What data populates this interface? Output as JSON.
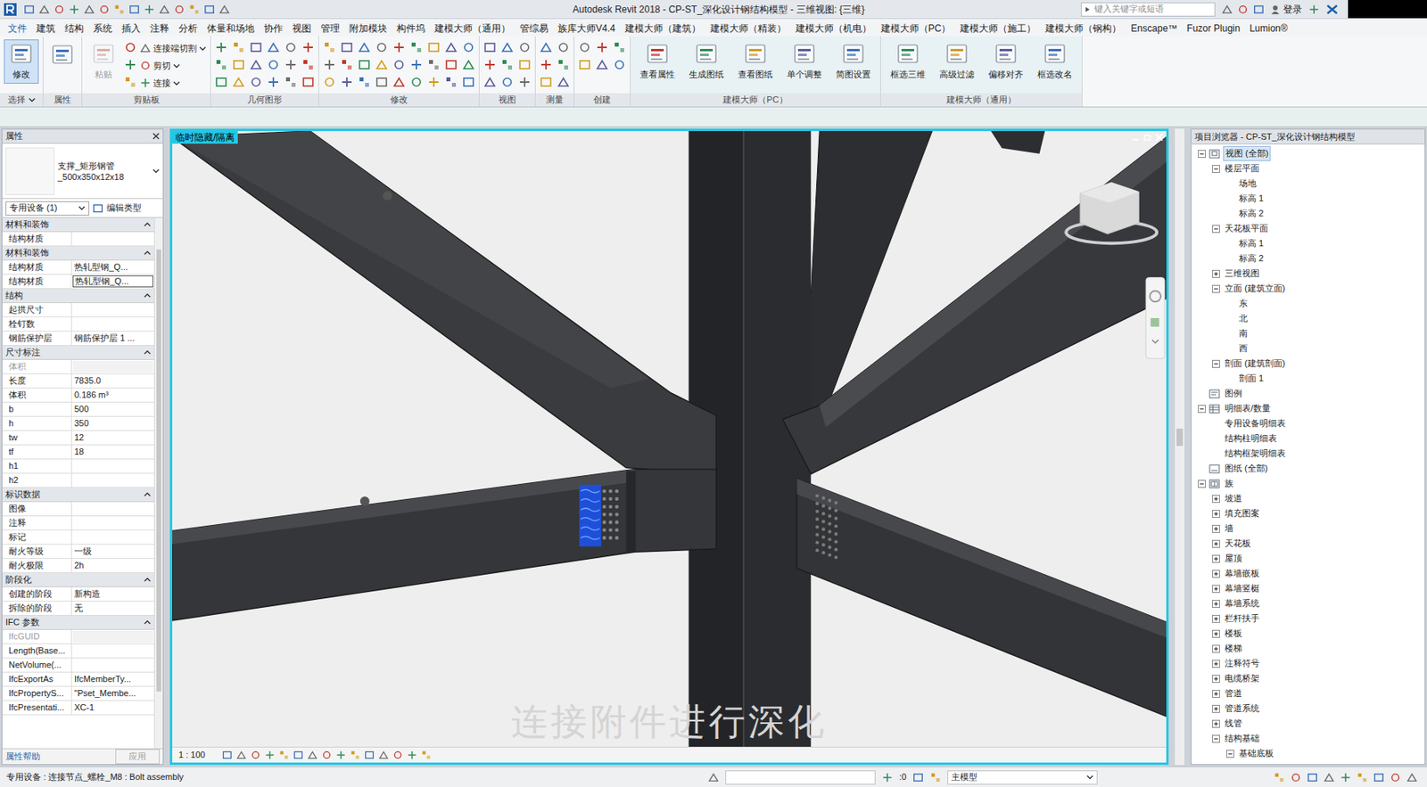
{
  "window": {
    "title": "Autodesk Revit 2018 -    CP-ST_深化设计钢结构模型 - 三维视图: {三维}",
    "search_placeholder": "键入关键字或短语",
    "login": "登录"
  },
  "tabs": [
    {
      "label": "文件",
      "selected": false
    },
    {
      "label": "建筑",
      "selected": false
    },
    {
      "label": "结构",
      "selected": false
    },
    {
      "label": "系统",
      "selected": false
    },
    {
      "label": "插入",
      "selected": false
    },
    {
      "label": "注释",
      "selected": false
    },
    {
      "label": "分析",
      "selected": false
    },
    {
      "label": "体量和场地",
      "selected": false
    },
    {
      "label": "协作",
      "selected": false
    },
    {
      "label": "视图",
      "selected": false
    },
    {
      "label": "管理",
      "selected": false
    },
    {
      "label": "附加模块",
      "selected": false
    },
    {
      "label": "构件坞",
      "selected": false
    },
    {
      "label": "建模大师（通用）",
      "selected": false
    },
    {
      "label": "管综易",
      "selected": false
    },
    {
      "label": "族库大师V4.4",
      "selected": false
    },
    {
      "label": "建模大师（建筑）",
      "selected": false
    },
    {
      "label": "建模大师（精装）",
      "selected": false
    },
    {
      "label": "建模大师（机电）",
      "selected": false
    },
    {
      "label": "建模大师（PC）",
      "selected": false
    },
    {
      "label": "建模大师（施工）",
      "selected": false
    },
    {
      "label": "建模大师（钢构）",
      "selected": false
    },
    {
      "label": "Enscape™",
      "selected": false
    },
    {
      "label": "Fuzor Plugin",
      "selected": false
    },
    {
      "label": "Lumion®",
      "selected": false
    }
  ],
  "ribbon": [
    {
      "label": "选择",
      "dropdown": true,
      "tinted": false,
      "large": [
        {
          "label": "修改",
          "selected": true,
          "disabled": false
        }
      ],
      "small": []
    },
    {
      "label": "属性",
      "dropdown": false,
      "tinted": false,
      "large": [],
      "small": []
    },
    {
      "label": "剪贴板",
      "dropdown": false,
      "tinted": false,
      "large": [
        {
          "label": "粘贴",
          "selected": false,
          "disabled": true
        }
      ],
      "small": [
        "连接端切割",
        "剪切",
        "连接"
      ]
    },
    {
      "label": "几何图形",
      "dropdown": false,
      "tinted": false,
      "large": [],
      "small": []
    },
    {
      "label": "修改",
      "dropdown": false,
      "tinted": false,
      "large": [],
      "small": []
    },
    {
      "label": "视图",
      "dropdown": false,
      "tinted": false,
      "large": [],
      "small": []
    },
    {
      "label": "测量",
      "dropdown": false,
      "tinted": false,
      "large": [],
      "small": []
    },
    {
      "label": "创建",
      "dropdown": false,
      "tinted": false,
      "large": [],
      "small": []
    },
    {
      "label": "建模大师（PC）",
      "dropdown": false,
      "tinted": true,
      "large": [
        {
          "label": "查看属性",
          "selected": false,
          "disabled": false
        },
        {
          "label": "生成图纸",
          "selected": false,
          "disabled": false
        },
        {
          "label": "查看图纸",
          "selected": false,
          "disabled": false
        },
        {
          "label": "单个调整",
          "selected": false,
          "disabled": false
        },
        {
          "label": "简图设置",
          "selected": false,
          "disabled": false
        }
      ],
      "small": []
    },
    {
      "label": "建模大师（通用）",
      "dropdown": false,
      "tinted": true,
      "large": [
        {
          "label": "框选三维",
          "selected": false,
          "disabled": false
        },
        {
          "label": "高级过滤",
          "selected": false,
          "disabled": false
        },
        {
          "label": "偏移对齐",
          "selected": false,
          "disabled": false
        },
        {
          "label": "框选改名",
          "selected": false,
          "disabled": false
        }
      ],
      "small": []
    }
  ],
  "properties": {
    "title": "属性",
    "type_lines": [
      "支撑_矩形钢管",
      "_500x350x12x18"
    ],
    "selector": "专用设备 (1)",
    "edit_type": "编辑类型",
    "groups": [
      {
        "label": "材料和装饰",
        "expanded": true,
        "rows": [
          {
            "name": "结构材质",
            "value": "",
            "disabled": false,
            "editing": false
          }
        ]
      },
      {
        "label": "材料和装饰",
        "expanded": true,
        "rows": [
          {
            "name": "结构材质",
            "value": "热轧型钢_Q...",
            "disabled": false,
            "editing": false
          },
          {
            "name": "结构材质",
            "value": "热轧型钢_Q...",
            "disabled": false,
            "editing": true
          }
        ]
      },
      {
        "label": "结构",
        "expanded": true,
        "rows": [
          {
            "name": "起拱尺寸",
            "value": "",
            "disabled": false,
            "editing": false
          },
          {
            "name": "栓钉数",
            "value": "",
            "disabled": false,
            "editing": false
          },
          {
            "name": "钢筋保护层",
            "value": "钢筋保护层 1 ...",
            "disabled": false,
            "editing": false
          }
        ]
      },
      {
        "label": "尺寸标注",
        "expanded": true,
        "rows": [
          {
            "name": "体积",
            "value": "",
            "disabled": true,
            "editing": false
          },
          {
            "name": "长度",
            "value": "7835.0",
            "disabled": false,
            "editing": false
          },
          {
            "name": "体积",
            "value": "0.186 m³",
            "disabled": false,
            "editing": false
          },
          {
            "name": "b",
            "value": "500",
            "disabled": false,
            "editing": false
          },
          {
            "name": "h",
            "value": "350",
            "disabled": false,
            "editing": false
          },
          {
            "name": "tw",
            "value": "12",
            "disabled": false,
            "editing": false
          },
          {
            "name": "tf",
            "value": "18",
            "disabled": false,
            "editing": false
          },
          {
            "name": "h1",
            "value": "",
            "disabled": false,
            "editing": false
          },
          {
            "name": "h2",
            "value": "",
            "disabled": false,
            "editing": false
          }
        ]
      },
      {
        "label": "标识数据",
        "expanded": true,
        "rows": [
          {
            "name": "图像",
            "value": "",
            "disabled": false,
            "editing": false
          },
          {
            "name": "注释",
            "value": "",
            "disabled": false,
            "editing": false
          },
          {
            "name": "标记",
            "value": "",
            "disabled": false,
            "editing": false
          },
          {
            "name": "耐火等级",
            "value": "一级",
            "disabled": false,
            "editing": false
          },
          {
            "name": "耐火极限",
            "value": "2h",
            "disabled": false,
            "editing": false
          }
        ]
      },
      {
        "label": "阶段化",
        "expanded": true,
        "rows": [
          {
            "name": "创建的阶段",
            "value": "新构造",
            "disabled": false,
            "editing": false
          },
          {
            "name": "拆除的阶段",
            "value": "无",
            "disabled": false,
            "editing": false
          }
        ]
      },
      {
        "label": "IFC 参数",
        "expanded": true,
        "rows": [
          {
            "name": "IfcGUID",
            "value": "",
            "disabled": true,
            "editing": false
          },
          {
            "name": "Length(Base...",
            "value": "",
            "disabled": false,
            "editing": false
          },
          {
            "name": "NetVolume(...",
            "value": "",
            "disabled": false,
            "editing": false
          },
          {
            "name": "IfcExportAs",
            "value": "IfcMemberTy...",
            "disabled": false,
            "editing": false
          },
          {
            "name": "IfcPropertyS...",
            "value": "\"Pset_Membe...",
            "disabled": false,
            "editing": false
          },
          {
            "name": "IfcPresentati...",
            "value": "XC-1",
            "disabled": false,
            "editing": false
          }
        ]
      }
    ],
    "help": "属性帮助",
    "apply": {
      "label": "应用",
      "disabled": true
    }
  },
  "viewport": {
    "label": "临时隐藏/隔离",
    "subtitle": "连接附件进行深化",
    "plate_selected": true,
    "scale": "1 : 100"
  },
  "browser": {
    "title": "项目浏览器 - CP-ST_深化设计钢结构模型",
    "items": [
      {
        "label": "视图 (全部)",
        "level": 0,
        "expandable": true,
        "expanded": true,
        "selected": true,
        "kind": "views"
      },
      {
        "label": "楼层平面",
        "level": 1,
        "expandable": true,
        "expanded": true,
        "selected": false,
        "kind": "none"
      },
      {
        "label": "场地",
        "level": 2,
        "expandable": false,
        "expanded": false,
        "selected": false,
        "kind": "none"
      },
      {
        "label": "标高 1",
        "level": 2,
        "expandable": false,
        "expanded": false,
        "selected": false,
        "kind": "none"
      },
      {
        "label": "标高 2",
        "level": 2,
        "expandable": false,
        "expanded": false,
        "selected": false,
        "kind": "none"
      },
      {
        "label": "天花板平面",
        "level": 1,
        "expandable": true,
        "expanded": true,
        "selected": false,
        "kind": "none"
      },
      {
        "label": "标高 1",
        "level": 2,
        "expandable": false,
        "expanded": false,
        "selected": false,
        "kind": "none"
      },
      {
        "label": "标高 2",
        "level": 2,
        "expandable": false,
        "expanded": false,
        "selected": false,
        "kind": "none"
      },
      {
        "label": "三维视图",
        "level": 1,
        "expandable": true,
        "expanded": false,
        "selected": false,
        "kind": "none"
      },
      {
        "label": "立面 (建筑立面)",
        "level": 1,
        "expandable": true,
        "expanded": true,
        "selected": false,
        "kind": "none"
      },
      {
        "label": "东",
        "level": 2,
        "expandable": false,
        "expanded": false,
        "selected": false,
        "kind": "none"
      },
      {
        "label": "北",
        "level": 2,
        "expandable": false,
        "expanded": false,
        "selected": false,
        "kind": "none"
      },
      {
        "label": "南",
        "level": 2,
        "expandable": false,
        "expanded": false,
        "selected": false,
        "kind": "none"
      },
      {
        "label": "西",
        "level": 2,
        "expandable": false,
        "expanded": false,
        "selected": false,
        "kind": "none"
      },
      {
        "label": "剖面 (建筑剖面)",
        "level": 1,
        "expandable": true,
        "expanded": true,
        "selected": false,
        "kind": "none"
      },
      {
        "label": "剖面 1",
        "level": 2,
        "expandable": false,
        "expanded": false,
        "selected": false,
        "kind": "none"
      },
      {
        "label": "图例",
        "level": 0,
        "expandable": false,
        "expanded": false,
        "selected": false,
        "kind": "legend"
      },
      {
        "label": "明细表/数量",
        "level": 0,
        "expandable": true,
        "expanded": true,
        "selected": false,
        "kind": "schedule"
      },
      {
        "label": "专用设备明细表",
        "level": 1,
        "expandable": false,
        "expanded": false,
        "selected": false,
        "kind": "none"
      },
      {
        "label": "结构柱明细表",
        "level": 1,
        "expandable": false,
        "expanded": false,
        "selected": false,
        "kind": "none"
      },
      {
        "label": "结构框架明细表",
        "level": 1,
        "expandable": false,
        "expanded": false,
        "selected": false,
        "kind": "none"
      },
      {
        "label": "图纸 (全部)",
        "level": 0,
        "expandable": false,
        "expanded": false,
        "selected": false,
        "kind": "sheet"
      },
      {
        "label": "族",
        "level": 0,
        "expandable": true,
        "expanded": true,
        "selected": false,
        "kind": "family"
      },
      {
        "label": "坡道",
        "level": 1,
        "expandable": true,
        "expanded": false,
        "selected": false,
        "kind": "none"
      },
      {
        "label": "填充图案",
        "level": 1,
        "expandable": true,
        "expanded": false,
        "selected": false,
        "kind": "none"
      },
      {
        "label": "墙",
        "level": 1,
        "expandable": true,
        "expanded": false,
        "selected": false,
        "kind": "none"
      },
      {
        "label": "天花板",
        "level": 1,
        "expandable": true,
        "expanded": false,
        "selected": false,
        "kind": "none"
      },
      {
        "label": "屋顶",
        "level": 1,
        "expandable": true,
        "expanded": false,
        "selected": false,
        "kind": "none"
      },
      {
        "label": "幕墙嵌板",
        "level": 1,
        "expandable": true,
        "expanded": false,
        "selected": false,
        "kind": "none"
      },
      {
        "label": "幕墙竖梃",
        "level": 1,
        "expandable": true,
        "expanded": false,
        "selected": false,
        "kind": "none"
      },
      {
        "label": "幕墙系统",
        "level": 1,
        "expandable": true,
        "expanded": false,
        "selected": false,
        "kind": "none"
      },
      {
        "label": "栏杆扶手",
        "level": 1,
        "expandable": true,
        "expanded": false,
        "selected": false,
        "kind": "none"
      },
      {
        "label": "楼板",
        "level": 1,
        "expandable": true,
        "expanded": false,
        "selected": false,
        "kind": "none"
      },
      {
        "label": "楼梯",
        "level": 1,
        "expandable": true,
        "expanded": false,
        "selected": false,
        "kind": "none"
      },
      {
        "label": "注释符号",
        "level": 1,
        "expandable": true,
        "expanded": false,
        "selected": false,
        "kind": "none"
      },
      {
        "label": "电缆桥架",
        "level": 1,
        "expandable": true,
        "expanded": false,
        "selected": false,
        "kind": "none"
      },
      {
        "label": "管道",
        "level": 1,
        "expandable": true,
        "expanded": false,
        "selected": false,
        "kind": "none"
      },
      {
        "label": "管道系统",
        "level": 1,
        "expandable": true,
        "expanded": false,
        "selected": false,
        "kind": "none"
      },
      {
        "label": "线管",
        "level": 1,
        "expandable": true,
        "expanded": false,
        "selected": false,
        "kind": "none"
      },
      {
        "label": "结构基础",
        "level": 1,
        "expandable": true,
        "expanded": true,
        "selected": false,
        "kind": "none"
      },
      {
        "label": "基础底板",
        "level": 2,
        "expandable": true,
        "expanded": true,
        "selected": false,
        "kind": "none"
      }
    ]
  },
  "status_bar": {
    "text": "专用设备 : 连接节点_螺栓_M8 : Bolt assembly",
    "count": ":0",
    "model": "主模型"
  }
}
